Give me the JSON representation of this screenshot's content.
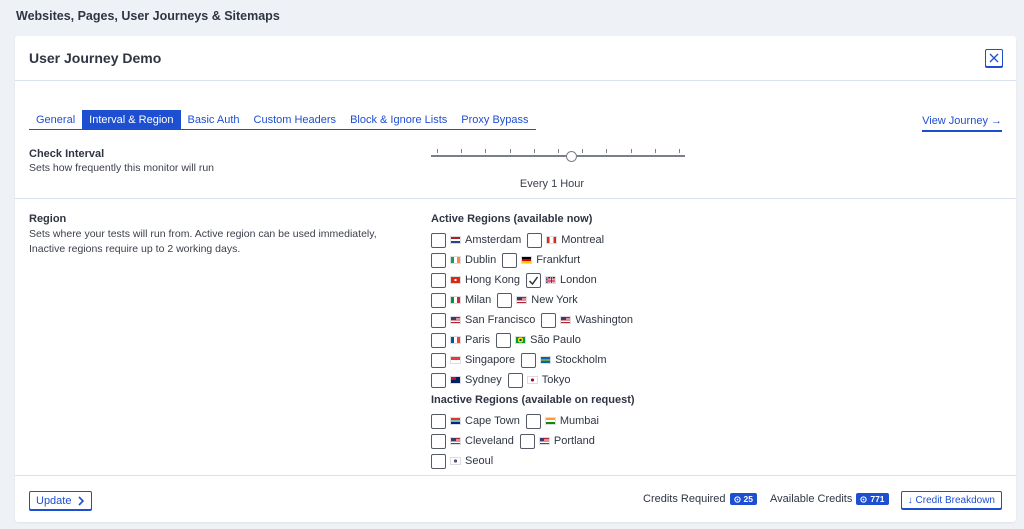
{
  "page": {
    "header": "Websites, Pages, User Journeys & Sitemaps"
  },
  "panel": {
    "title": "User Journey Demo"
  },
  "tabs": [
    {
      "label": "General",
      "active": false
    },
    {
      "label": "Interval & Region",
      "active": true
    },
    {
      "label": "Basic Auth",
      "active": false
    },
    {
      "label": "Custom Headers",
      "active": false
    },
    {
      "label": "Block & Ignore Lists",
      "active": false
    },
    {
      "label": "Proxy Bypass",
      "active": false
    }
  ],
  "view_journey": "View Journey →",
  "check_interval": {
    "label": "Check Interval",
    "description": "Sets how frequently this monitor will run",
    "value": "Every 1 Hour",
    "slider_position": 0.55
  },
  "region": {
    "label": "Region",
    "description_line1": "Sets where your tests will run from. Active region can be used immediately,",
    "description_line2": "Inactive regions require up to 2 working days."
  },
  "active_regions": {
    "heading": "Active Regions (available now)",
    "rows": [
      [
        {
          "name": "Amsterdam",
          "flag": "nl",
          "checked": false
        },
        {
          "name": "Montreal",
          "flag": "ca",
          "checked": false
        }
      ],
      [
        {
          "name": "Dublin",
          "flag": "ie",
          "checked": false
        },
        {
          "name": "Frankfurt",
          "flag": "de",
          "checked": false
        }
      ],
      [
        {
          "name": "Hong Kong",
          "flag": "hk",
          "checked": false
        },
        {
          "name": "London",
          "flag": "gb",
          "checked": true
        }
      ],
      [
        {
          "name": "Milan",
          "flag": "it",
          "checked": false
        },
        {
          "name": "New York",
          "flag": "us",
          "checked": false
        }
      ],
      [
        {
          "name": "San Francisco",
          "flag": "us",
          "checked": false
        },
        {
          "name": "Washington",
          "flag": "us",
          "checked": false
        }
      ],
      [
        {
          "name": "Paris",
          "flag": "fr",
          "checked": false
        },
        {
          "name": "São Paulo",
          "flag": "br",
          "checked": false
        }
      ],
      [
        {
          "name": "Singapore",
          "flag": "sg",
          "checked": false
        },
        {
          "name": "Stockholm",
          "flag": "se",
          "checked": false
        }
      ],
      [
        {
          "name": "Sydney",
          "flag": "au",
          "checked": false
        },
        {
          "name": "Tokyo",
          "flag": "jp",
          "checked": false
        }
      ]
    ]
  },
  "inactive_regions": {
    "heading": "Inactive Regions (available on request)",
    "rows": [
      [
        {
          "name": "Cape Town",
          "flag": "za",
          "checked": false
        },
        {
          "name": "Mumbai",
          "flag": "in",
          "checked": false
        }
      ],
      [
        {
          "name": "Cleveland",
          "flag": "us",
          "checked": false
        },
        {
          "name": "Portland",
          "flag": "us",
          "checked": false
        }
      ],
      [
        {
          "name": "Seoul",
          "flag": "kr",
          "checked": false
        }
      ]
    ]
  },
  "footer": {
    "update_label": "Update",
    "credits_required_label": "Credits Required",
    "credits_required_value": "25",
    "available_credits_label": "Available Credits",
    "available_credits_value": "771",
    "breakdown_label": "↓ Credit Breakdown"
  },
  "colors": {
    "accent": "#1f4fd1",
    "background": "#eef1f6",
    "divider": "#d9e2ef"
  },
  "icons": {
    "close": "close-icon",
    "update": "chevron-right-icon",
    "check": "check-icon",
    "credit": "coin-icon"
  }
}
